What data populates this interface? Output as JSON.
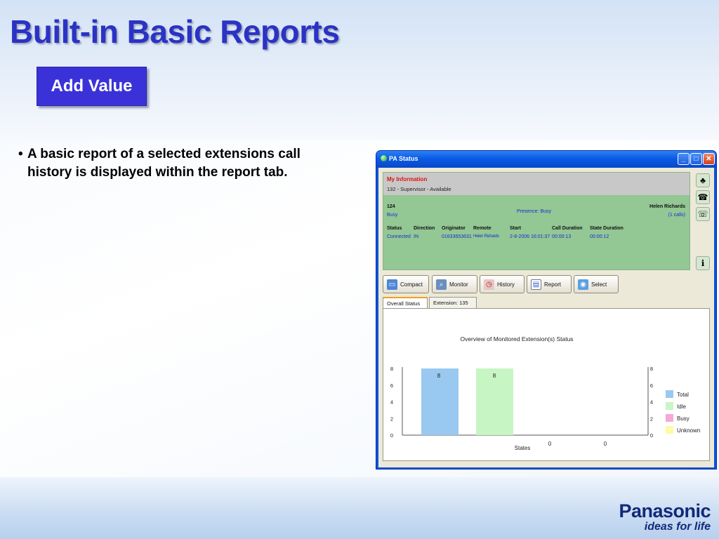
{
  "slide": {
    "title": "Built-in Basic Reports",
    "badge": "Add Value",
    "bullet_dot": "•",
    "bullet": "A basic report of a selected extensions call history is displayed within the report tab.",
    "brand": "Panasonic",
    "tagline": "ideas for life"
  },
  "window": {
    "title": "PA Status",
    "controls": {
      "minimize": "_",
      "maximize": "□",
      "close": "✕"
    },
    "my_info": {
      "label": "My Information",
      "status": "132 - Supervisor - Available"
    },
    "extension": {
      "number": "124",
      "state": "Busy",
      "presence": "Presence:  Busy",
      "name": "Helen Richards",
      "calls": "(1 calls)"
    },
    "call_table": {
      "headers": [
        "Status",
        "Direction",
        "Originator",
        "Remote",
        "Start",
        "Call Duration",
        "State Duration"
      ],
      "row": [
        "Connected",
        "IN",
        "01633653631",
        "Helen Richards",
        "2-8-2006 16:01:37",
        "00:00:13",
        "00:00:12"
      ]
    },
    "side_icons": [
      "users-icon",
      "phone-transfer-icon",
      "conference-icon",
      "info-icon"
    ],
    "toolbar": [
      {
        "label": "Compact",
        "icon": "compact-icon"
      },
      {
        "label": "Monitor",
        "icon": "monitor-icon"
      },
      {
        "label": "History",
        "icon": "history-icon"
      },
      {
        "label": "Report",
        "icon": "report-icon"
      },
      {
        "label": "Select",
        "icon": "select-icon"
      }
    ],
    "tabs": [
      {
        "label": "Overall Status",
        "active": true
      },
      {
        "label": "Extension: 135",
        "active": false
      }
    ]
  },
  "chart_data": {
    "type": "bar",
    "title": "Overview of Monitored Extension(s) Status",
    "xlabel": "States",
    "ylabel": "",
    "ylim": [
      0,
      8
    ],
    "yticks": [
      0,
      2,
      4,
      6,
      8
    ],
    "categories": [
      "Total",
      "Idle",
      "Busy",
      "Unknown"
    ],
    "values": [
      8,
      8,
      0,
      0
    ],
    "colors": [
      "#99c9f0",
      "#c8f5c4",
      "#f7a8d6",
      "#fdfaa8"
    ],
    "legend": [
      "Total",
      "Idle",
      "Busy",
      "Unknown"
    ],
    "legend_position": "right",
    "grid": false
  },
  "colors": {
    "title": "#2a33c4",
    "badge": "#3a32d8",
    "panel_green": "#93c794",
    "brand": "#12287a"
  }
}
